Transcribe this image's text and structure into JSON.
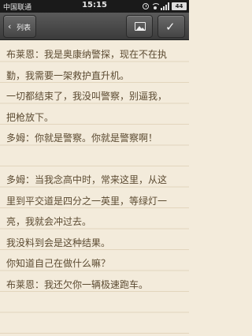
{
  "status_bar": {
    "carrier": "中国联通",
    "time": "15:15",
    "battery": "44"
  },
  "toolbar": {
    "back_label": "列表",
    "back_icon": "chevron-left-icon",
    "image_icon": "image-icon",
    "save_icon": "checkmark-icon"
  },
  "note": {
    "lines": [
      "布莱恩：我是奥康纳警探，现在不在执",
      "勤，我需要一架救护直升机。",
      "一切都结束了，我没叫警察，别逼我，",
      "把枪放下。",
      "多姆：你就是警察。你就是警察啊！",
      "",
      "多姆：当我念高中时，常来这里，从这",
      "里到平交道是四分之一英里，等绿灯一",
      "亮，我就会冲过去。",
      "我没料到会是这种结果。",
      "你知道自己在做什么嘛？",
      "布莱恩：我还欠你一辆极速跑车。",
      ""
    ]
  }
}
